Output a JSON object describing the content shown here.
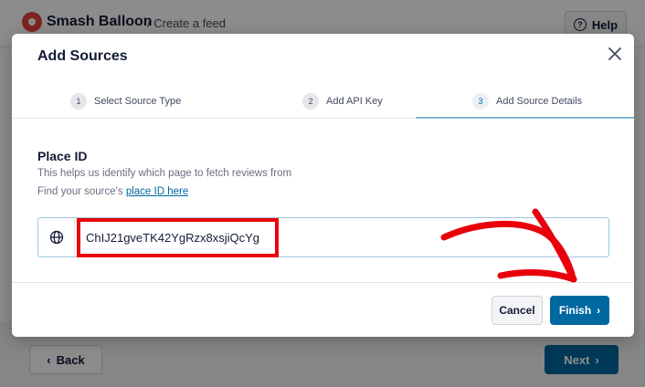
{
  "background": {
    "brand": "Smash Balloon",
    "breadcrumb": "/ Create a feed",
    "help_label": "Help",
    "back_label": "Back",
    "next_label": "Next"
  },
  "modal": {
    "title": "Add Sources",
    "steps": [
      {
        "number": "1",
        "label": "Select Source Type"
      },
      {
        "number": "2",
        "label": "Add API Key"
      },
      {
        "number": "3",
        "label": "Add Source Details"
      }
    ],
    "active_step": 3,
    "field": {
      "label": "Place ID",
      "help": "This helps us identify which page to fetch reviews from",
      "link_prefix": "Find your source's",
      "link_text": "place ID here",
      "value": "ChIJ21gveTK42YgRzx8xsjiQcYg"
    },
    "cancel_label": "Cancel",
    "finish_label": "Finish"
  },
  "colors": {
    "primary": "#0068a0",
    "brand_red": "#e8413c",
    "annotation_red": "#e8000b"
  },
  "icons": [
    "balloon-logo-icon",
    "help-icon",
    "close-icon",
    "globe-icon",
    "chevron-right-icon",
    "chevron-left-icon",
    "annotation-arrow"
  ]
}
